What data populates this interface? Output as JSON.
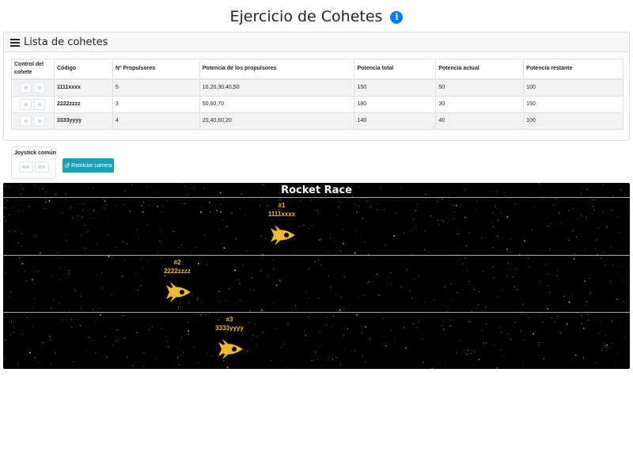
{
  "page": {
    "title": "Ejercicio de Cohetes",
    "info_icon": "i"
  },
  "card": {
    "title": "Lista de cohetes"
  },
  "table": {
    "headers": [
      "Control del cohete",
      "Código",
      "Nº Propulsores",
      "Potencia de los propulsores",
      "Potencia total",
      "Potencia actual",
      "Potencia restante"
    ],
    "rows": [
      {
        "code": "1111xxxx",
        "propulsores": "5",
        "potencias": "10,20,30,40,50",
        "total": "150",
        "actual": "50",
        "restante": "100"
      },
      {
        "code": "2222zzzz",
        "propulsores": "3",
        "potencias": "50,60,70",
        "total": "180",
        "actual": "30",
        "restante": "150"
      },
      {
        "code": "3333yyyy",
        "propulsores": "4",
        "potencias": "20,40,60,20",
        "total": "140",
        "actual": "40",
        "restante": "100"
      }
    ],
    "brake_label": "«",
    "accel_label": "»"
  },
  "joystick": {
    "label": "Joystick común",
    "brake_label": "««",
    "accel_label": "»»"
  },
  "reset": {
    "label": "Reiniciar carrera",
    "icon": "↺"
  },
  "race": {
    "title": "Rocket Race",
    "rockets": [
      {
        "rank": "#1",
        "code": "1111xxxx"
      },
      {
        "rank": "#2",
        "code": "2222zzzz"
      },
      {
        "rank": "#3",
        "code": "3333yyyy"
      }
    ]
  },
  "colors": {
    "rocket": "#f0ba2c",
    "reset_button": "#17a2b8",
    "info_icon": "#007bff",
    "accel_buttons": "#5fa1ec"
  }
}
